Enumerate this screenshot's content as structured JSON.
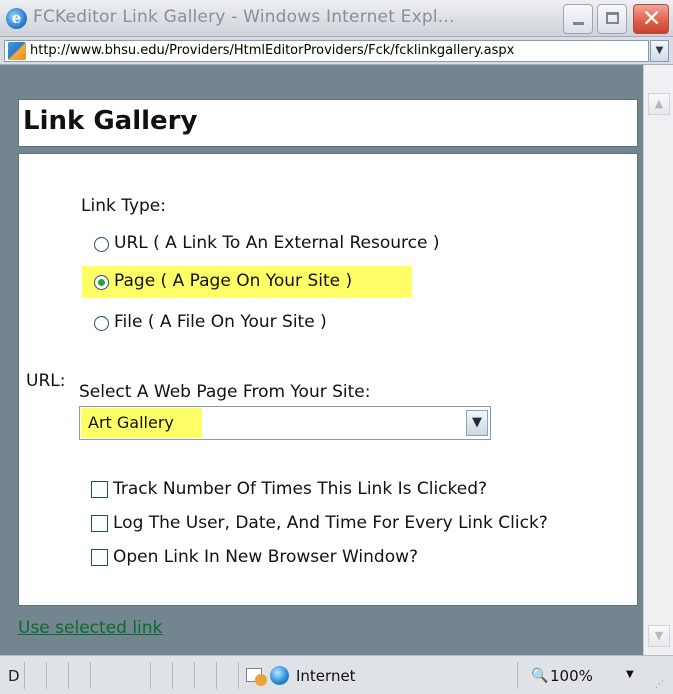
{
  "window": {
    "title": "FCKeditor Link Gallery - Windows Internet Expl...",
    "url": "http://www.bhsu.edu/Providers/HtmlEditorProviders/Fck/fcklinkgallery.aspx"
  },
  "page": {
    "heading": "Link Gallery",
    "link_type_label": "Link Type:",
    "link_types": [
      {
        "label": "URL ( A Link To An External Resource )",
        "checked": false
      },
      {
        "label": "Page ( A Page On Your Site )",
        "checked": true
      },
      {
        "label": "File ( A File On Your Site )",
        "checked": false
      }
    ],
    "url_label": "URL:",
    "select_prompt": "Select A Web Page From Your Site:",
    "selected_page": "Art Gallery",
    "options": [
      {
        "label": "Track Number Of Times This Link Is Clicked?",
        "checked": false
      },
      {
        "label": "Log The User, Date, And Time For Every Link Click?",
        "checked": false
      },
      {
        "label": "Open Link In New Browser Window?",
        "checked": false
      }
    ],
    "use_link": "Use selected link"
  },
  "status": {
    "left_text": "D",
    "zone": "Internet",
    "zoom": "100%"
  },
  "colors": {
    "highlight": "#ffff66",
    "frame": "#73858f",
    "link": "#0a6d2e"
  }
}
